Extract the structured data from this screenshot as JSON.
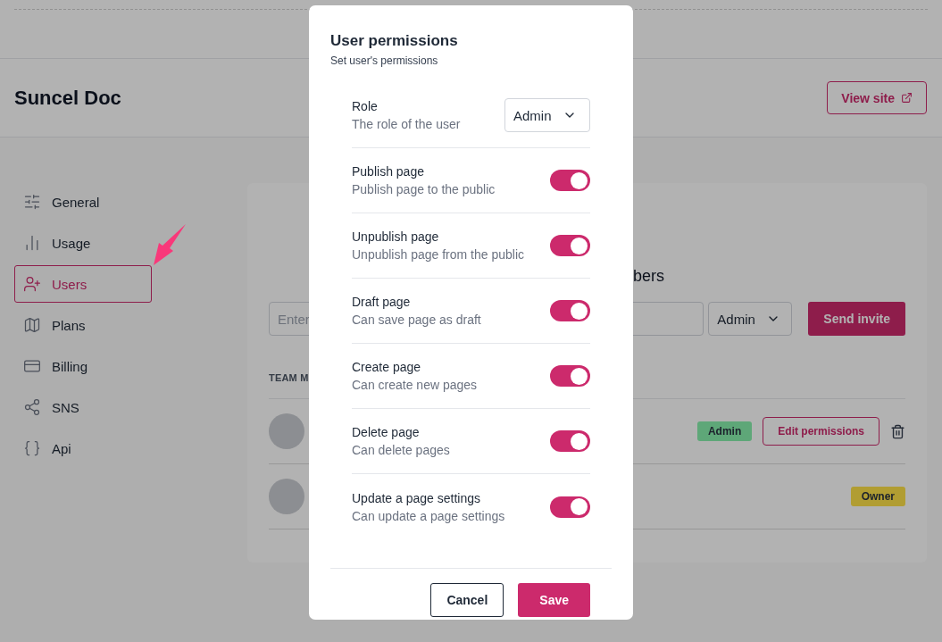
{
  "header": {
    "title": "Suncel Doc",
    "view_site_button": "View site"
  },
  "sidebar": {
    "items": [
      {
        "label": "General",
        "selected": false
      },
      {
        "label": "Usage",
        "selected": false
      },
      {
        "label": "Users",
        "selected": true
      },
      {
        "label": "Plans",
        "selected": false
      },
      {
        "label": "Billing",
        "selected": false
      },
      {
        "label": "SNS",
        "selected": false
      },
      {
        "label": "Api",
        "selected": false
      }
    ]
  },
  "team_card": {
    "heading_fragment": "bers",
    "invite": {
      "placeholder": "Enter",
      "role": "Admin",
      "button": "Send invite"
    },
    "column_heading": "TEAM M",
    "members": [
      {
        "role": "Admin",
        "color": "#5ea778",
        "edit_button": "Edit permissions",
        "deletable": true
      },
      {
        "role": "Owner",
        "color": "#b19d32",
        "deletable": false
      }
    ]
  },
  "modal": {
    "title": "User permissions",
    "subtitle": "Set user's permissions",
    "role": {
      "label": "Role",
      "description": "The role of the user",
      "value": "Admin"
    },
    "permissions": [
      {
        "label": "Publish page",
        "description": "Publish page to the public",
        "on": true
      },
      {
        "label": "Unpublish page",
        "description": "Unpublish page from the public",
        "on": true
      },
      {
        "label": "Draft page",
        "description": "Can save page as draft",
        "on": true
      },
      {
        "label": "Create page",
        "description": "Can create new pages",
        "on": true
      },
      {
        "label": "Delete page",
        "description": "Can delete pages",
        "on": true
      },
      {
        "label": "Update a page settings",
        "description": "Can update a page settings",
        "on": true
      }
    ],
    "cancel_button": "Cancel",
    "save_button": "Save"
  }
}
